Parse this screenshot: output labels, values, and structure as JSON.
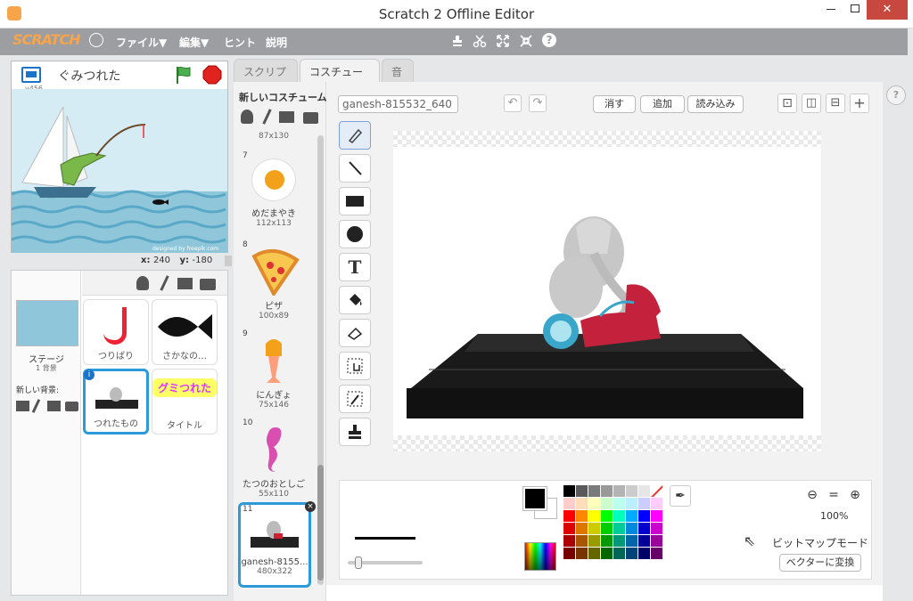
{
  "window": {
    "title": "Scratch 2 Offline Editor"
  },
  "menu": {
    "logo": "SCRATCH",
    "file": "ファイル▼",
    "edit": "編集▼",
    "hint": "ヒント",
    "about": "説明"
  },
  "stage": {
    "project_name": "ぐみつれた",
    "version": "v456",
    "x_label": "x:",
    "x_value": "240",
    "y_label": "y:",
    "y_value": "-180",
    "credit": "designed by freepik.com"
  },
  "sprites": {
    "stage_label": "ステージ",
    "stage_sub": "1 背景",
    "new_backdrop": "新しい背景:",
    "items": [
      {
        "label": "つりばり"
      },
      {
        "label": "さかなの…"
      },
      {
        "label": "つれたもの"
      },
      {
        "label": "タイトル"
      }
    ],
    "title_logo": "グミつれた"
  },
  "tabs": [
    {
      "label": "スクリプト"
    },
    {
      "label": "コスチューム"
    },
    {
      "label": "音"
    }
  ],
  "costumes": {
    "new_label": "新しいコスチューム:",
    "top_dim": "87x130",
    "items": [
      {
        "index": "7",
        "name": "めだまやき",
        "dim": "112x113"
      },
      {
        "index": "8",
        "name": "ピザ",
        "dim": "100x89"
      },
      {
        "index": "9",
        "name": "にんぎょ",
        "dim": "75x146"
      },
      {
        "index": "10",
        "name": "たつのおとしご",
        "dim": "55x110"
      },
      {
        "index": "11",
        "name": "ganesh-8155...",
        "dim": "480x322"
      }
    ]
  },
  "editor": {
    "costume_name": "ganesh-815532_640",
    "clear": "消す",
    "add": "追加",
    "import": "読み込み",
    "zoom": "100%",
    "mode": "ビットマップモード",
    "convert": "ベクターに変換"
  },
  "palette": {
    "colors": [
      "#000000",
      "#5a5a5a",
      "#7a7a7a",
      "#999999",
      "#b3b3b3",
      "#cccccc",
      "#e6e6e6",
      "#ffffff",
      "#ffcccc",
      "#ffddbb",
      "#ffffbb",
      "#ccffcc",
      "#bbffee",
      "#bbeeff",
      "#ccccff",
      "#ffccff",
      "#ff0000",
      "#ff8800",
      "#ffff00",
      "#00ff00",
      "#00ffbb",
      "#00aaff",
      "#0000ff",
      "#ff00ff",
      "#dd0000",
      "#dd7700",
      "#cccc00",
      "#00cc00",
      "#00cc99",
      "#0088dd",
      "#0000cc",
      "#cc00cc",
      "#aa0000",
      "#aa5500",
      "#999900",
      "#009900",
      "#009977",
      "#0066aa",
      "#000099",
      "#990099",
      "#770000",
      "#773300",
      "#666600",
      "#006600",
      "#006655",
      "#004477",
      "#000066",
      "#660066"
    ]
  }
}
